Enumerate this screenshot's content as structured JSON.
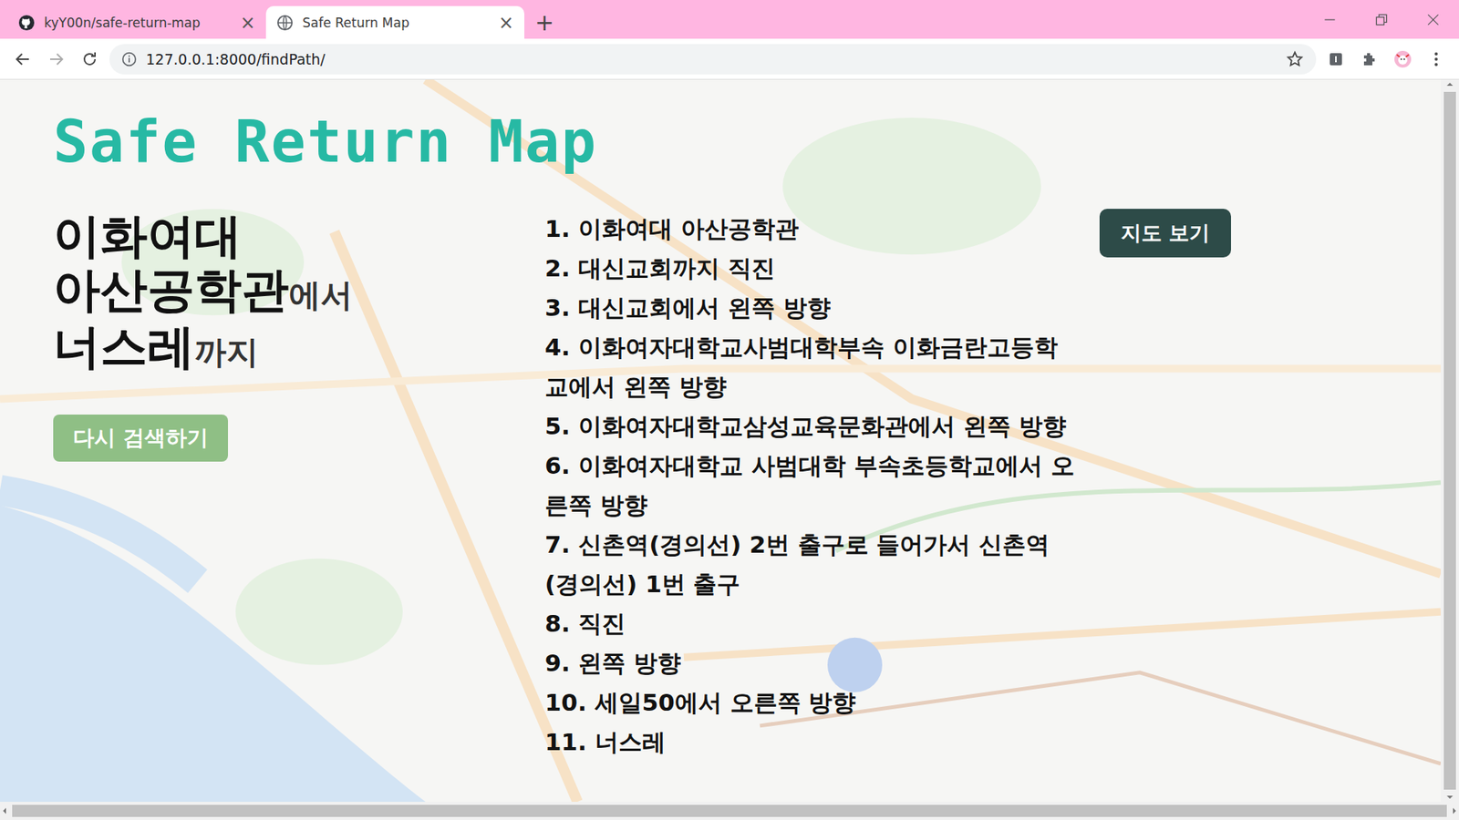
{
  "tabs": [
    {
      "label": "kyY00n/safe-return-map",
      "selected": false,
      "close": "×"
    },
    {
      "label": "Safe Return Map",
      "selected": true,
      "close": "×"
    }
  ],
  "new_tab": "+",
  "address_bar": {
    "url": "127.0.0.1:8000/findPath/"
  },
  "page": {
    "title": "Safe Return Map",
    "origin": "이화여대 아산공학관",
    "origin_suffix": "에서",
    "destination": "너스레",
    "destination_suffix": "까지",
    "search_again_button": "다시 검색하기",
    "map_button": "지도 보기",
    "steps": [
      "1. 이화여대 아산공학관",
      "2. 대신교회까지 직진",
      "3. 대신교회에서 왼쪽 방향",
      "4. 이화여자대학교사범대학부속 이화금란고등학교에서 왼쪽 방향",
      "5. 이화여자대학교삼성교육문화관에서 왼쪽 방향",
      "6. 이화여자대학교 사범대학 부속초등학교에서 오른쪽 방향",
      "7. 신촌역(경의선) 2번 출구로 들어가서 신촌역(경의선) 1번 출구",
      "8. 직진",
      "9. 왼쪽 방향",
      "10. 세일50에서 오른쪽 방향",
      "11. 너스레"
    ]
  }
}
